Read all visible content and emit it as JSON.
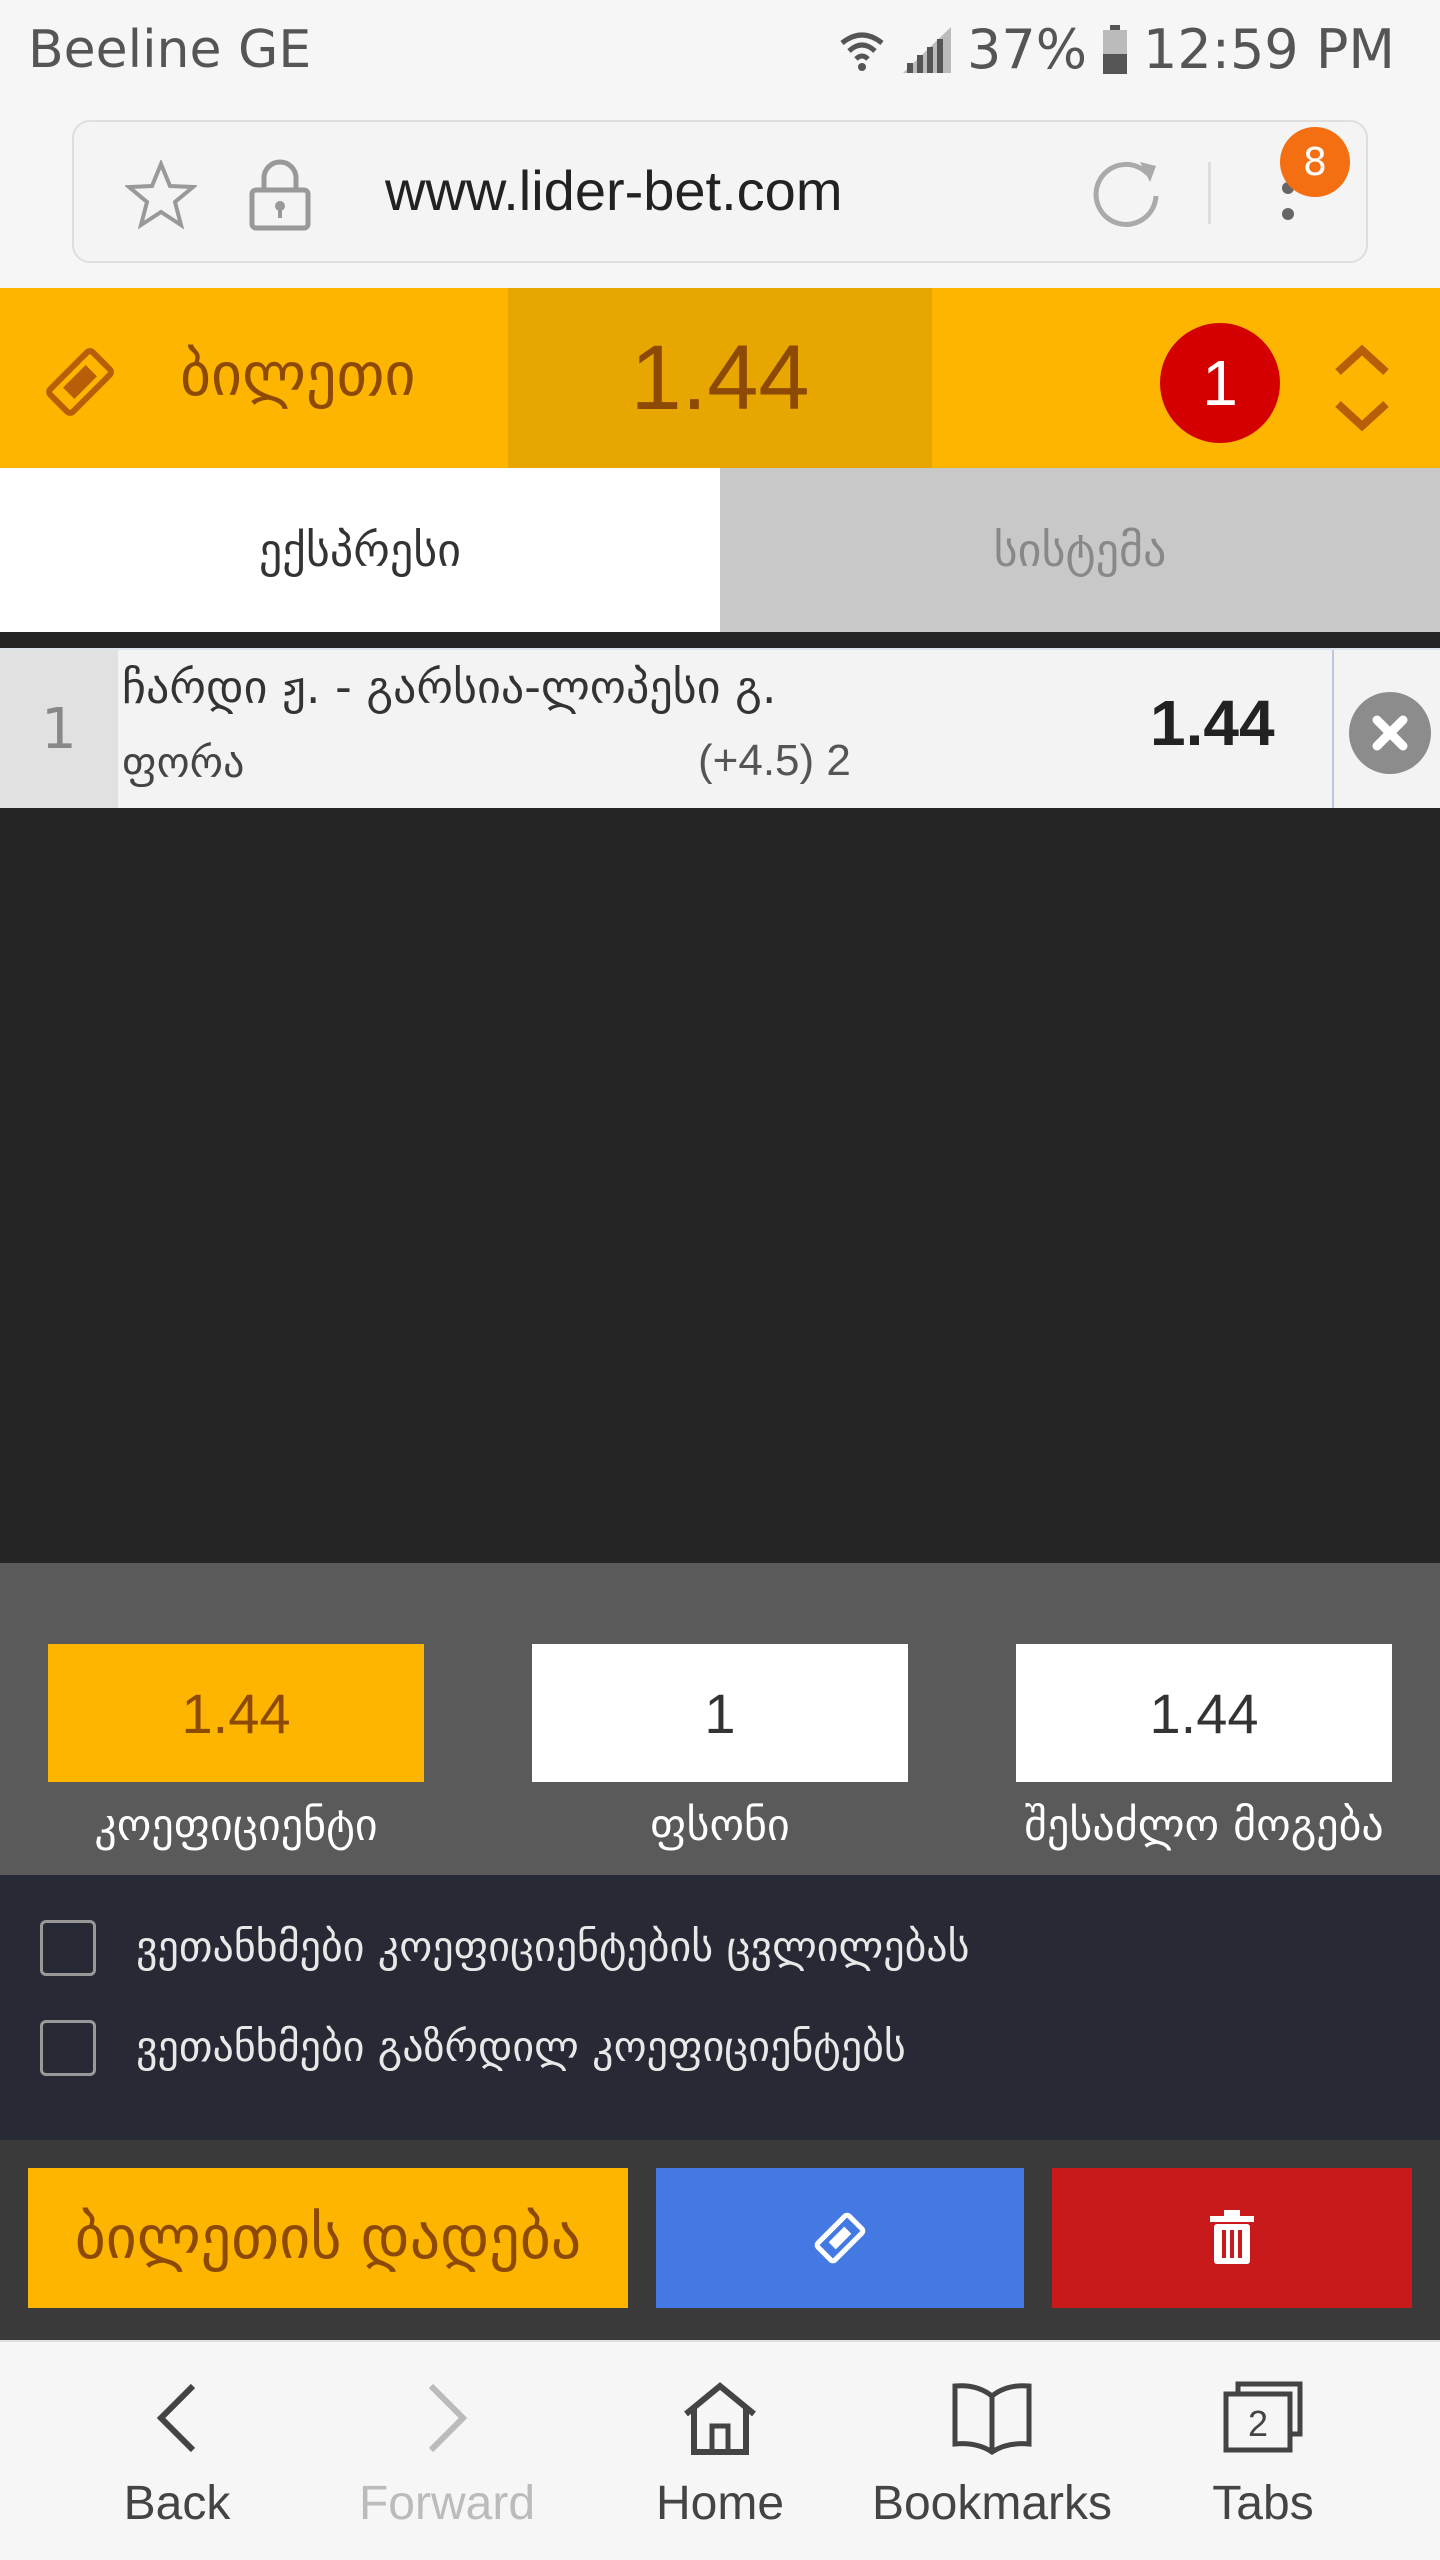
{
  "status_bar": {
    "carrier": "Beeline GE",
    "battery": "37%",
    "time": "12:59 PM"
  },
  "browser": {
    "url": "www.lider-bet.com",
    "tab_count_badge": "8"
  },
  "bet_slip": {
    "title": "ბილეთი",
    "total_odds": "1.44",
    "selection_count": "1",
    "tabs": [
      "ექსპრესი",
      "სისტემა"
    ],
    "bets": [
      {
        "index": "1",
        "match": "ჩარდი ჟ. - გარსია-ლოპესი გ.",
        "market": "ფორა",
        "selection": "(+4.5) 2",
        "odds": "1.44"
      }
    ],
    "summary": {
      "odds_value": "1.44",
      "odds_label": "კოეფიციენტი",
      "stake_value": "1",
      "stake_label": "ფსონი",
      "win_value": "1.44",
      "win_label": "შესაძლო მოგება"
    },
    "agreements": [
      "ვეთანხმები კოეფიციენტების ცვლილებას",
      "ვეთანხმები გაზრდილ კოეფიციენტებს"
    ],
    "place_bet_label": "ბილეთის დადება"
  },
  "bottom_nav": {
    "back": "Back",
    "forward": "Forward",
    "home": "Home",
    "bookmarks": "Bookmarks",
    "tabs": "Tabs",
    "tabs_count": "2"
  },
  "colors": {
    "accent_yellow": "#fdb500",
    "accent_brown": "#8c4a06",
    "badge_red": "#d40000",
    "ticket_blue": "#4479e3",
    "delete_red": "#c81a1a"
  }
}
